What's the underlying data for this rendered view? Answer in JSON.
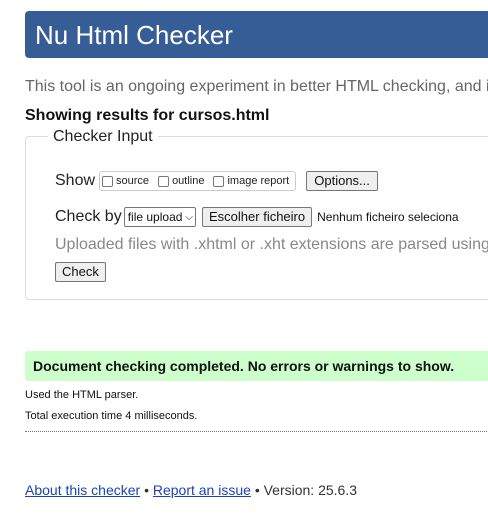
{
  "header": {
    "title": "Nu Html Checker"
  },
  "intro_text": "This tool is an ongoing experiment in better HTML checking, and i",
  "results_heading": "Showing results for cursos.html",
  "checker_input": {
    "legend": "Checker Input",
    "show_label": "Show",
    "show_options": [
      {
        "label": "source",
        "checked": false
      },
      {
        "label": "outline",
        "checked": false
      },
      {
        "label": "image report",
        "checked": false
      }
    ],
    "options_button": "Options...",
    "check_by_label": "Check by",
    "check_by_selected": "file upload",
    "choose_file_button": "Escolher ficheiro",
    "file_status": "Nenhum ficheiro seleciona",
    "note": "Uploaded files with .xhtml or .xht extensions are parsed using",
    "check_button": "Check"
  },
  "result": {
    "success_message": "Document checking completed. No errors or warnings to show.",
    "parser_used": "Used the HTML parser.",
    "execution_time": "Total execution time 4 milliseconds.",
    "success_color": "#ccffcc"
  },
  "footer": {
    "about_link": "About this checker",
    "separator": "•",
    "report_link": "Report an issue",
    "version_text": "Version: 25.6.3"
  },
  "colors": {
    "banner": "#365d95",
    "link": "#1a44b8"
  }
}
